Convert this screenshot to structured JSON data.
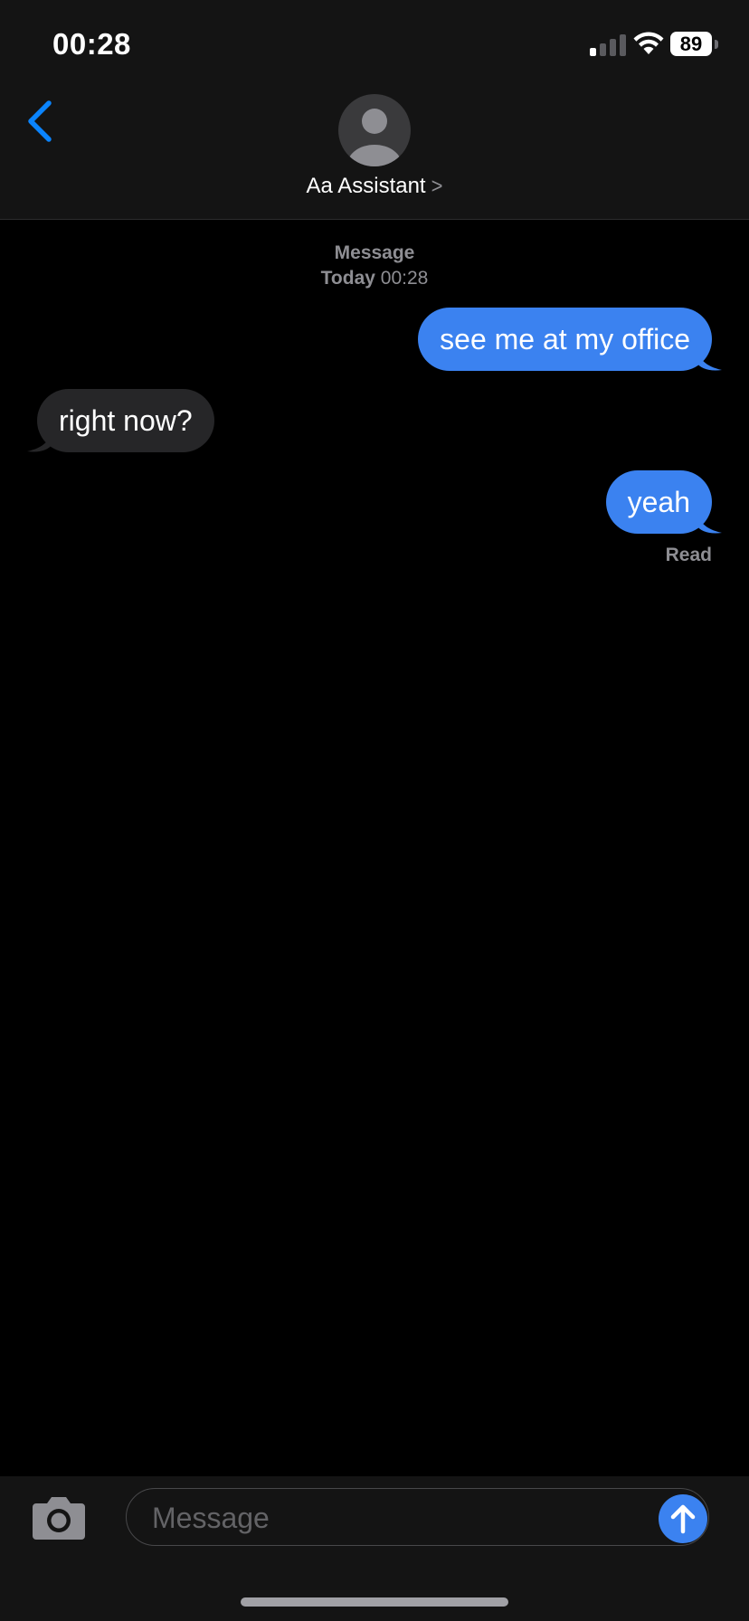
{
  "status_bar": {
    "time": "00:28",
    "battery": "89",
    "signal_bars_active": 1,
    "signal_bars_total": 4
  },
  "header": {
    "back_icon": "chevron-left-icon",
    "avatar_icon": "person-silhouette-icon",
    "contact_name": "Aa Assistant",
    "contact_chevron": ">"
  },
  "conversation": {
    "service": "Message",
    "day": "Today",
    "time": "00:28",
    "messages": [
      {
        "direction": "outgoing",
        "text": "see me at my office"
      },
      {
        "direction": "incoming",
        "text": "right now?"
      },
      {
        "direction": "outgoing",
        "text": "yeah"
      }
    ],
    "receipt": "Read"
  },
  "composer": {
    "camera_icon": "camera-icon",
    "placeholder": "Message",
    "value": "",
    "send_icon": "arrow-up-icon"
  },
  "colors": {
    "accent": "#3b82f0",
    "back_chevron": "#0a84ff",
    "incoming_bubble": "#262628",
    "background": "#000000",
    "bar_background": "#141414"
  }
}
